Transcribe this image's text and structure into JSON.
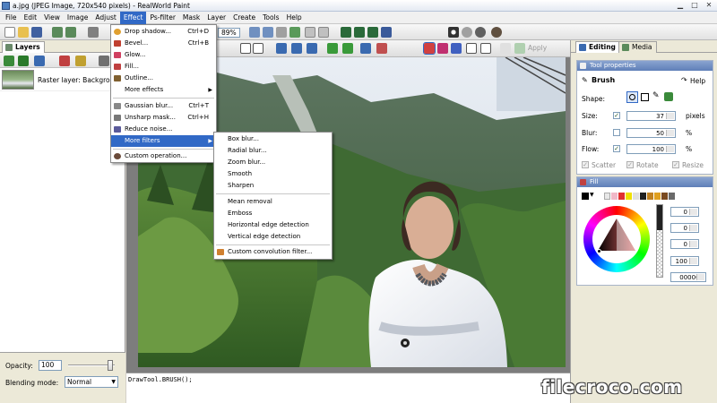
{
  "window": {
    "title": "a.jpg (JPEG Image, 720x540 pixels) - RealWorld Paint"
  },
  "menubar": {
    "items": [
      "File",
      "Edit",
      "View",
      "Image",
      "Adjust",
      "Effect",
      "Ps-filter",
      "Mask",
      "Layer",
      "Create",
      "Tools",
      "Help"
    ],
    "active": "Effect"
  },
  "toolbar": {
    "zoom": "89%",
    "apply_label": "Apply"
  },
  "left_panel": {
    "tab_label": "Layers",
    "layer_name": "Raster layer: Background",
    "opacity_label": "Opacity:",
    "opacity_value": "100",
    "blending_label": "Blending mode:",
    "blending_value": "Normal"
  },
  "effect_menu": {
    "items": [
      {
        "label": "Drop shadow...",
        "shortcut": "Ctrl+D"
      },
      {
        "label": "Bevel...",
        "shortcut": "Ctrl+B"
      },
      {
        "label": "Glow...",
        "shortcut": ""
      },
      {
        "label": "Fill...",
        "shortcut": ""
      },
      {
        "label": "Outline...",
        "shortcut": ""
      },
      {
        "label": "More effects",
        "shortcut": ""
      },
      {
        "label": "Gaussian blur...",
        "shortcut": "Ctrl+T"
      },
      {
        "label": "Unsharp mask...",
        "shortcut": "Ctrl+H"
      },
      {
        "label": "Reduce noise...",
        "shortcut": ""
      },
      {
        "label": "More filters",
        "shortcut": ""
      },
      {
        "label": "Custom operation...",
        "shortcut": ""
      }
    ]
  },
  "filters_submenu": {
    "items": [
      "Box blur...",
      "Radial blur...",
      "Zoom blur...",
      "Smooth",
      "Sharpen",
      "Mean removal",
      "Emboss",
      "Horizontal edge detection",
      "Vertical edge detection",
      "Custom convolution filter..."
    ]
  },
  "console": {
    "text": "DrawTool.BRUSH();"
  },
  "right_panel": {
    "tabs": [
      "Editing",
      "Media"
    ],
    "tool_properties": {
      "header": "Tool properties",
      "tool_name": "Brush",
      "help_label": "Help",
      "shape_label": "Shape:",
      "size_label": "Size:",
      "size_value": "37",
      "size_unit": "pixels",
      "blur_label": "Blur:",
      "blur_value": "50",
      "blur_unit": "%",
      "flow_label": "Flow:",
      "flow_value": "100",
      "flow_unit": "%",
      "scatter_label": "Scatter",
      "rotate_label": "Rotate",
      "resize_label": "Resize"
    },
    "fill": {
      "header": "Fill",
      "values": [
        "0",
        "0",
        "0",
        "100"
      ],
      "hex": "000000"
    }
  },
  "watermark": "filecroco.com",
  "colors": {
    "accent": "#3169c6",
    "panel": "#ece9d8"
  }
}
